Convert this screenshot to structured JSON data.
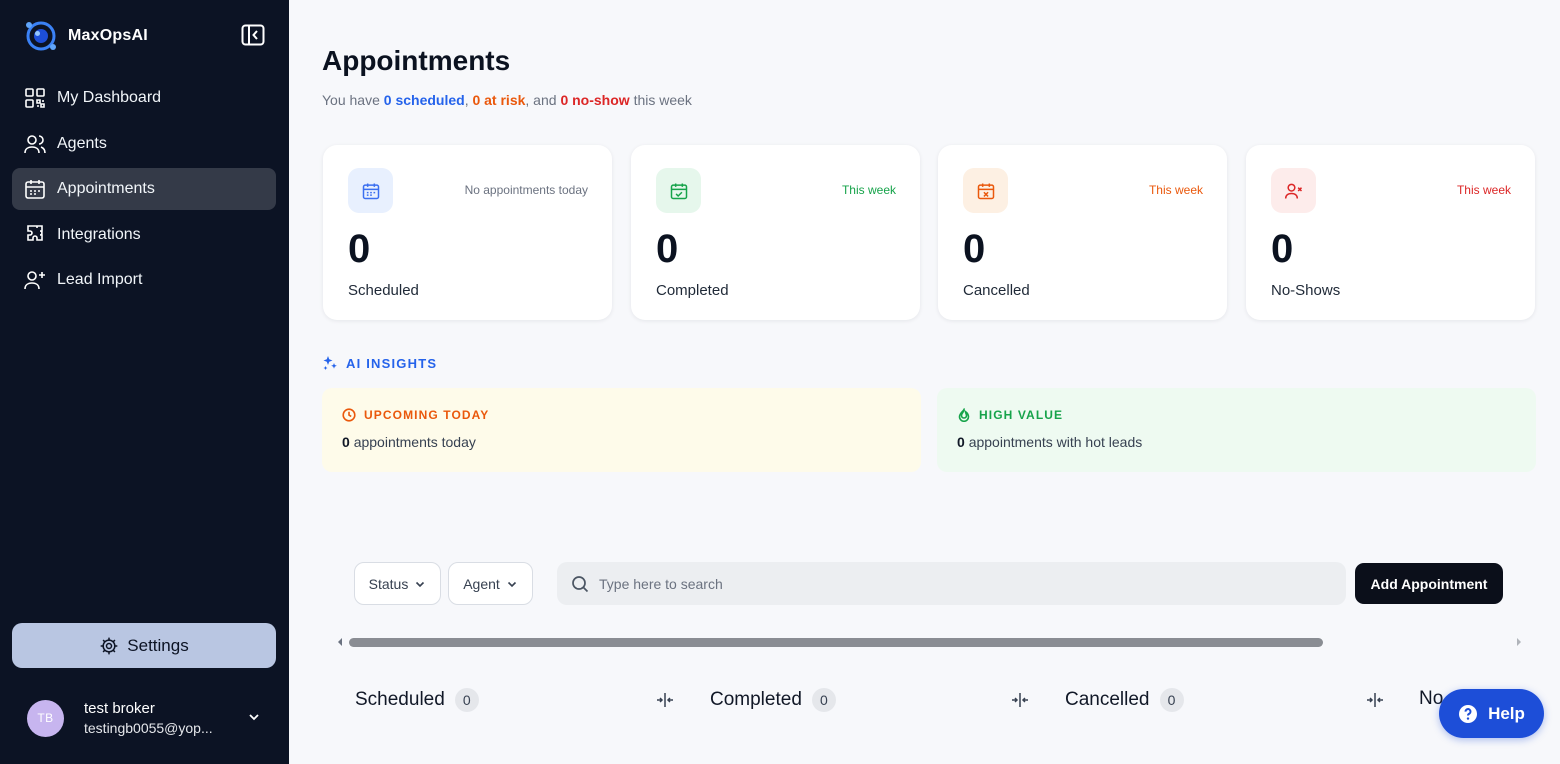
{
  "app": {
    "logo_text": "MaxOpsAI"
  },
  "sidebar": {
    "items": [
      {
        "label": "My Dashboard",
        "icon": "dashboard-icon"
      },
      {
        "label": "Agents",
        "icon": "users-icon"
      },
      {
        "label": "Appointments",
        "icon": "calendar-icon",
        "active": true
      },
      {
        "label": "Integrations",
        "icon": "puzzle-icon"
      },
      {
        "label": "Lead Import",
        "icon": "user-plus-icon"
      }
    ],
    "settings_label": "Settings",
    "user": {
      "initials": "TB",
      "name": "test broker",
      "email": "testingb0055@yop..."
    }
  },
  "header": {
    "title": "Appointments",
    "subtitle_prefix": "You have",
    "scheduled_text": "0 scheduled",
    "at_risk_text": "0 at risk",
    "no_show_text": "0 no-show",
    "subtitle_suffix": "this week"
  },
  "stats": [
    {
      "value": "0",
      "label": "Scheduled",
      "note": "No appointments today",
      "note_color": "#6b7280",
      "icon_bg": "#e8f0fe",
      "icon_color": "#3b6ff0"
    },
    {
      "value": "0",
      "label": "Completed",
      "note": "This week",
      "note_color": "#16a34a",
      "icon_bg": "#e6f7ec",
      "icon_color": "#16a34a"
    },
    {
      "value": "0",
      "label": "Cancelled",
      "note": "This week",
      "note_color": "#ea580c",
      "icon_bg": "#fdf0e3",
      "icon_color": "#ea580c"
    },
    {
      "value": "0",
      "label": "No-Shows",
      "note": "This week",
      "note_color": "#dc2626",
      "icon_bg": "#fdeceb",
      "icon_color": "#dc2626"
    }
  ],
  "ai_insights": {
    "heading": "AI INSIGHTS",
    "upcoming": {
      "title": "UPCOMING TODAY",
      "count": "0",
      "text": "appointments today",
      "color": "#ea580c",
      "bg": "#fefbea"
    },
    "high_value": {
      "title": "HIGH VALUE",
      "count": "0",
      "text": "appointments with hot leads",
      "color": "#16a34a",
      "bg": "#eefaf1"
    }
  },
  "toolbar": {
    "status_label": "Status",
    "agent_label": "Agent",
    "search_placeholder": "Type here to search",
    "add_label": "Add Appointment"
  },
  "columns": [
    {
      "label": "Scheduled",
      "count": "0"
    },
    {
      "label": "Completed",
      "count": "0"
    },
    {
      "label": "Cancelled",
      "count": "0"
    },
    {
      "label": "No",
      "count": ""
    }
  ],
  "help": {
    "label": "Help"
  },
  "scroll": {
    "visible_fraction": 0.84,
    "offset_fraction": 0
  }
}
